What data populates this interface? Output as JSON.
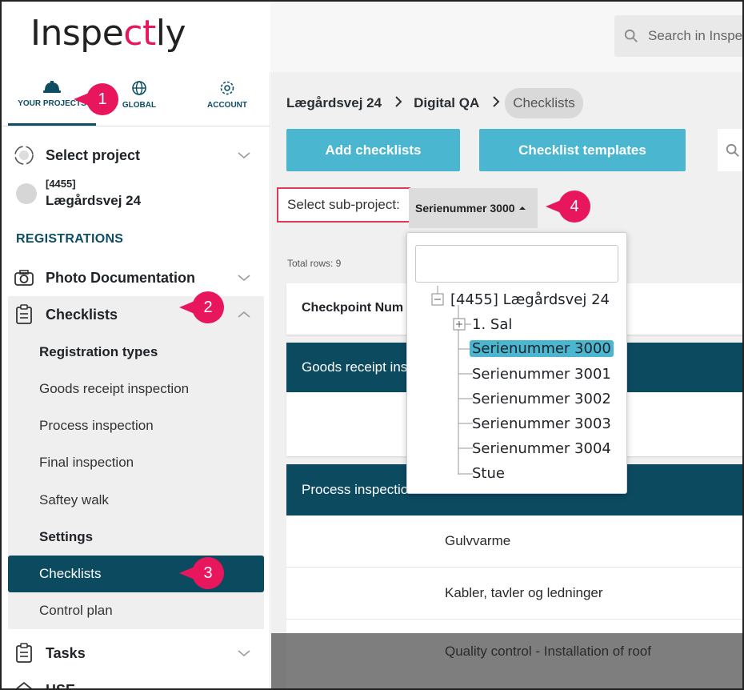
{
  "brand": {
    "logo_text_1": "Inspe",
    "logo_text_2": "ct",
    "logo_text_3": "ly",
    "accent": "#e8175d",
    "primary": "#0c4a60",
    "button": "#4ab6d0"
  },
  "header": {
    "search_placeholder": "Search in Inspe"
  },
  "sidebar": {
    "tabs": [
      {
        "label": "YOUR PROJECTS",
        "icon": "hardhat-icon"
      },
      {
        "label": "GLOBAL",
        "icon": "globe-icon"
      },
      {
        "label": "ACCOUNT",
        "icon": "gear-icon"
      }
    ],
    "select_project": "Select project",
    "project_number": "[4455]",
    "project_name": "Lægårdsvej 24",
    "registrations_label": "REGISTRATIONS",
    "photo_documentation": "Photo Documentation",
    "checklists": "Checklists",
    "checklist_sub": {
      "registration_types": "Registration types",
      "goods_receipt": "Goods receipt inspection",
      "process_inspection": "Process inspection",
      "final_inspection": "Final inspection",
      "saftey_walk": "Saftey walk",
      "settings": "Settings",
      "checklists_active": "Checklists",
      "control_plan": "Control plan"
    },
    "tasks": "Tasks",
    "hse": "HSE"
  },
  "breadcrumb": {
    "item1": "Lægårdsvej 24",
    "item2": "Digital QA",
    "item3": "Checklists"
  },
  "toolbar": {
    "add_checklists": "Add checklists",
    "checklist_templates": "Checklist templates"
  },
  "subproject": {
    "label": "Select sub-project:",
    "selected": "Serienummer 3000"
  },
  "table": {
    "total_rows": "Total rows: 9",
    "header_col": "Checkpoint Num",
    "group1": "Goods receipt ins",
    "group2": "Process inspection",
    "rows": [
      "Gulvvarme",
      "Kabler, tavler og ledninger",
      "Quality control - Installation of roof"
    ]
  },
  "tree": {
    "root": "[4455] Lægårdsvej 24",
    "child1": "1. Sal",
    "items": [
      "Serienummer 3000",
      "Serienummer 3001",
      "Serienummer 3002",
      "Serienummer 3003",
      "Serienummer 3004",
      "Stue"
    ]
  },
  "badges": [
    "1",
    "2",
    "3",
    "4"
  ]
}
